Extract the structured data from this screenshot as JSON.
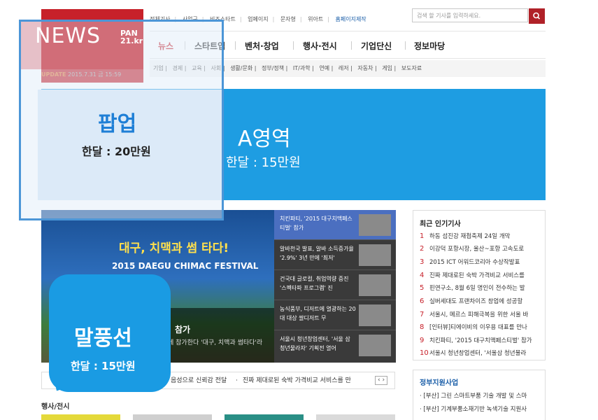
{
  "header": {
    "top_links": [
      "전체기사",
      "사업구",
      "비즈스타트",
      "업페이지",
      "문자형",
      "위아트"
    ],
    "top_link_highlight": "홈페이지제작",
    "search_placeholder": "검색 할 기사를 입력하세요.",
    "nav": [
      "뉴스",
      "스타트업",
      "벤처·창업",
      "행사·전시",
      "기업단신",
      "정보마당"
    ],
    "subnav": [
      "기업",
      "경제",
      "교육",
      "사회",
      "생활/문화",
      "정부/정책",
      "IT/과학",
      "연예",
      "레저",
      "자동차",
      "게임",
      "보도자료"
    ],
    "update_label": "UPDATE",
    "update_time": "2015.7.31 금 15:59"
  },
  "popup": {
    "news_label": "NEWS",
    "badge_top": "PAN",
    "badge_bottom": "21.kr",
    "title": "팝업",
    "price": "한달 : 20만원"
  },
  "a_area": {
    "title": "A영역",
    "price": "한달 : 15만원"
  },
  "main_photo": {
    "headline": "대구, 치맥과 썸 타다!",
    "festival": "2015 DAEGU CHIMAC FESTIVAL",
    "caption_title": "참가",
    "caption_sub": "에 참가한다 '대구, 치맥과 썸타다'라"
  },
  "news_list": [
    "치킨파티, '2015 대구치맥페스티벌' 참가",
    "알바천국 발표, 알바 소득증가율 '2.9%' 3년 만에 '최저'",
    "건국대 글로컬, 취업역량 증진 '스펙타파 프로그램' 진",
    "농식품부, 디저트에 열광하는 20대 대상 쌀디저트 무",
    "서울시 청년창업센터, '서울 삼 청년물라자' 기획전 열어"
  ],
  "bubble": {
    "title": "말풍선",
    "price": "한달 : 15만원"
  },
  "ticker": {
    "text1": "음성으로 신뢰감 전달",
    "text2": "진짜 제대로된 숙박 가격비교 서비스를 만",
    "arrows": "‹ ›"
  },
  "section_head": "행사/전시",
  "popular": {
    "title": "최근 인기기사",
    "items": [
      {
        "num": "1",
        "text": "하동 섬진강 재첩축제 24일 개막"
      },
      {
        "num": "2",
        "text": "이강덕 포항시장, 울산~포항 고속도로"
      },
      {
        "num": "3",
        "text": "2015 ICT 어워드코리아 수상작발표"
      },
      {
        "num": "4",
        "text": "진짜 제대로된 숙박 가격비교 서비스를"
      },
      {
        "num": "5",
        "text": "핀연구소, 8월 6일 명인이 전수하는 발"
      },
      {
        "num": "6",
        "text": "실버세대도 프랜차이즈 창업에 성공할"
      },
      {
        "num": "7",
        "text": "서울시, 메르스 피해극복을 위한 서울 바"
      },
      {
        "num": "8",
        "text": "[인터뷰]티에이비의 이우용 대표를 만나"
      },
      {
        "num": "9",
        "text": "치킨파티, '2015 대구치맥페스티벌' 참가"
      },
      {
        "num": "10",
        "text": "서울시 청년창업센터, '서울삼 청년물라"
      }
    ]
  },
  "startup": {
    "title": "정부지원사업",
    "items": [
      "[부산] 그린 스마트부품 기술 개발 및 스마",
      "[부산] 기계부품소재기반 녹색기술 지원사"
    ]
  },
  "colors": {
    "brand_red": "#c7212a",
    "a_area_blue": "#1e9de2",
    "bubble_blue": "#1a9be3",
    "popup_border": "#4c96d7"
  }
}
